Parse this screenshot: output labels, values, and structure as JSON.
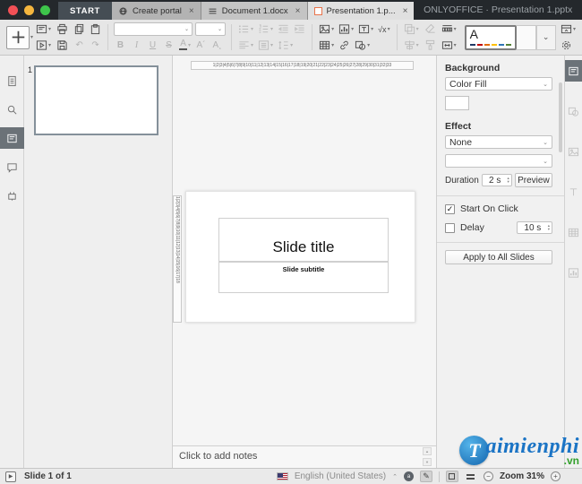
{
  "window": {
    "start_label": "START",
    "tabs": [
      {
        "label": "Create portal"
      },
      {
        "label": "Document 1.docx"
      },
      {
        "label": "Presentation 1.p..."
      }
    ],
    "title": "ONLYOFFICE · Presentation 1.pptx",
    "traffic_lights": [
      "#f25056",
      "#f5b63e",
      "#3ec54b"
    ]
  },
  "toolbar": {
    "font_name": "",
    "font_size": "",
    "theme_letter": "A",
    "theme_palette": [
      "#1f3864",
      "#c00000",
      "#e36c09",
      "#ffc000",
      "#2e74b5",
      "#548235"
    ]
  },
  "icons": {
    "close": "×",
    "caret": "▾",
    "chevron_down": "⌄",
    "chevron_up": "⌃",
    "spin_up": "▴",
    "spin_down": "▾",
    "undo": "↶",
    "redo": "↷",
    "play": "▶",
    "minus": "−",
    "plus": "+",
    "check": "✓",
    "pencil": "✎",
    "bold": "B",
    "italic": "I",
    "underline": "U",
    "strike": "S",
    "font_color": "A",
    "superscript": "A´",
    "subscript": "A¸",
    "equation": "√x",
    "spell": "a"
  },
  "slide_panel": {
    "slide_number": "1"
  },
  "rulers": {
    "horizontal": "1|2|3|4|5|6|7|8|9|10|11|12|13|14|15|16|17|18|19|20|21|22|23|24|25|26|27|28|29|30|31|32|33",
    "vertical": "1|2|3|4|5|6|7|8|9|10|11|12|13|14|15|16|17|18"
  },
  "slide": {
    "title": "Slide title",
    "subtitle": "Slide subtitle"
  },
  "notes": {
    "placeholder": "Click to add notes"
  },
  "right_panel": {
    "background_label": "Background",
    "background_value": "Color Fill",
    "effect_label": "Effect",
    "effect_value": "None",
    "duration_label": "Duration",
    "duration_value": "2 s",
    "preview_label": "Preview",
    "start_on_click_label": "Start On Click",
    "delay_label": "Delay",
    "delay_value": "10 s",
    "apply_label": "Apply to All Slides"
  },
  "statusbar": {
    "slide_count": "Slide 1 of 1",
    "language": "English (United States)",
    "zoom": "Zoom 31%"
  },
  "watermark": {
    "initial": "T",
    "name": "aimienphi",
    "domain": ".vn"
  }
}
